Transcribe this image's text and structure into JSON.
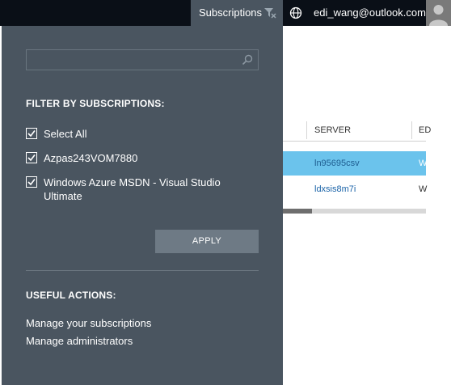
{
  "topbar": {
    "subscriptions_label": "Subscriptions",
    "filter_icon": "filter-icon",
    "globe_icon": "globe-icon",
    "user_email": "edi_wang@outlook.com",
    "avatar_icon": "user-avatar-icon"
  },
  "filter": {
    "search_placeholder": "",
    "search_icon": "search-icon",
    "heading": "FILTER BY SUBSCRIPTIONS:",
    "options": [
      {
        "label": "Select All",
        "checked": true
      },
      {
        "label": "Azpas243VOM7880",
        "checked": true
      },
      {
        "label": "Windows Azure MSDN - Visual Studio Ultimate",
        "checked": true
      }
    ],
    "apply_label": "APPLY"
  },
  "actions": {
    "heading": "USEFUL ACTIONS:",
    "links": [
      "Manage your subscriptions",
      "Manage administrators"
    ]
  },
  "table": {
    "columns": [
      "SERVER",
      "ED"
    ],
    "rows": [
      {
        "server": "ln95695csv",
        "edition": "W",
        "selected": true
      },
      {
        "server": "ldxsis8m7i",
        "edition": "W",
        "selected": false
      }
    ]
  },
  "colors": {
    "topbar": "#0a0f17",
    "panel": "#4a5560",
    "selected_row": "#6bc3ec",
    "link": "#1a63a8"
  }
}
